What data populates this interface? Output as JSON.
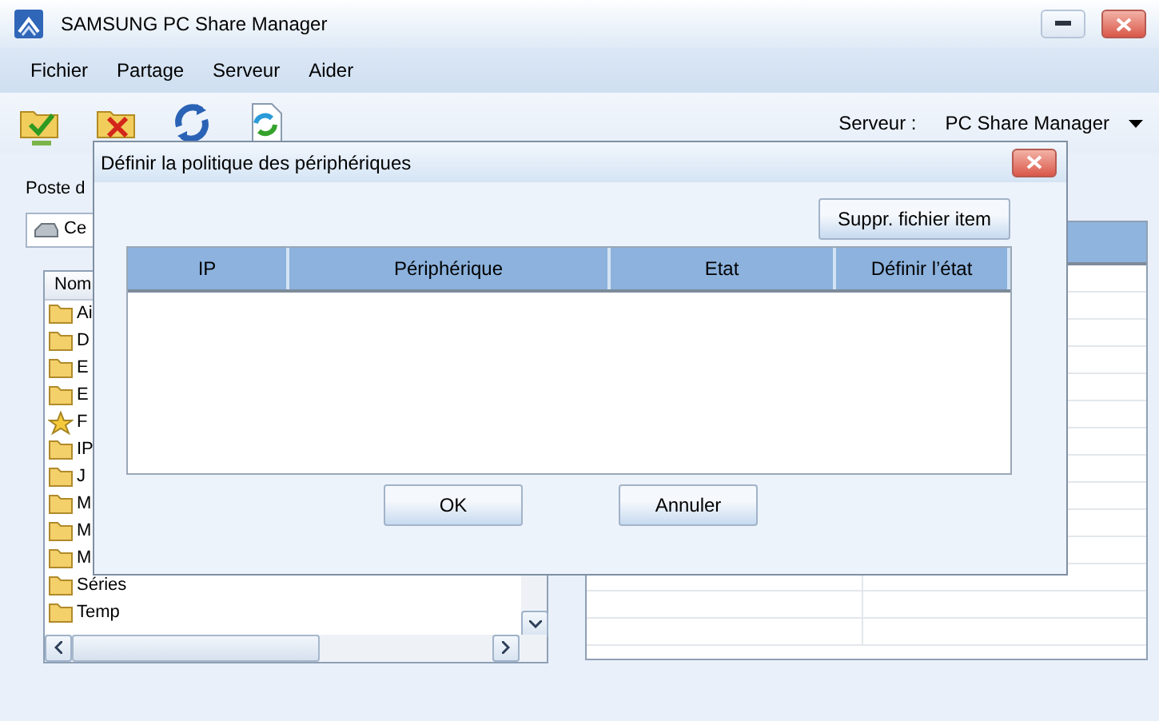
{
  "window": {
    "title": "SAMSUNG PC Share Manager"
  },
  "menu": [
    "Fichier",
    "Partage",
    "Serveur",
    "Aider"
  ],
  "server": {
    "label": "Serveur :",
    "value": "PC Share Manager"
  },
  "left_panel": {
    "label": "Poste d",
    "drive": "Ce",
    "tree_column": "Nom",
    "items": [
      {
        "name": "Ai",
        "kind": "folder"
      },
      {
        "name": "D",
        "kind": "folder"
      },
      {
        "name": "E",
        "kind": "folder"
      },
      {
        "name": "E",
        "kind": "folder"
      },
      {
        "name": "F",
        "kind": "star"
      },
      {
        "name": "IP",
        "kind": "folder"
      },
      {
        "name": "J",
        "kind": "folder"
      },
      {
        "name": "M",
        "kind": "folder"
      },
      {
        "name": "M",
        "kind": "folder"
      },
      {
        "name": "M",
        "kind": "folder"
      },
      {
        "name": "Séries",
        "kind": "folder"
      },
      {
        "name": "Temp",
        "kind": "folder"
      }
    ]
  },
  "dialog": {
    "title": "Définir la politique des périphériques",
    "action": "Suppr. fichier item",
    "columns": [
      "IP",
      "Périphérique",
      "Etat",
      "Définir l’état"
    ],
    "buttons": [
      "OK",
      "Annuler"
    ]
  }
}
